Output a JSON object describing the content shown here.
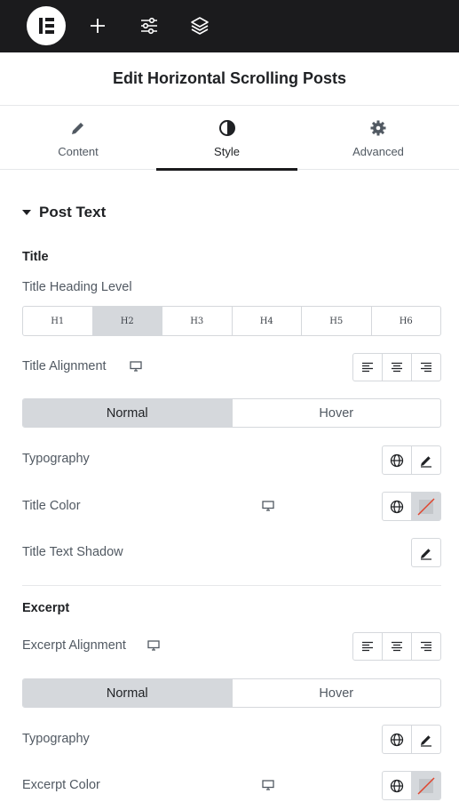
{
  "topbar": {
    "logo": "elementor-logo",
    "icons": [
      "plus-icon",
      "sliders-icon",
      "layers-icon"
    ]
  },
  "header": {
    "title": "Edit Horizontal Scrolling Posts"
  },
  "tabs": [
    {
      "label": "Content",
      "icon": "pencil-icon"
    },
    {
      "label": "Style",
      "icon": "contrast-icon",
      "active": true
    },
    {
      "label": "Advanced",
      "icon": "gear-icon"
    }
  ],
  "section": {
    "title": "Post Text"
  },
  "title_group": {
    "heading": "Title",
    "heading_level_label": "Title Heading Level",
    "heading_levels": [
      "H1",
      "H2",
      "H3",
      "H4",
      "H5",
      "H6"
    ],
    "heading_level_selected": "H2",
    "alignment_label": "Title Alignment",
    "state_normal": "Normal",
    "state_hover": "Hover",
    "typography_label": "Typography",
    "color_label": "Title Color",
    "shadow_label": "Title Text Shadow"
  },
  "excerpt_group": {
    "heading": "Excerpt",
    "alignment_label": "Excerpt Alignment",
    "state_normal": "Normal",
    "state_hover": "Hover",
    "typography_label": "Typography",
    "color_label": "Excerpt Color"
  },
  "colors": {
    "topbar": "#1b1b1d",
    "active_segment": "#d5d8dc",
    "border": "#d5d8dc",
    "unset_slash": "#e0452e"
  }
}
